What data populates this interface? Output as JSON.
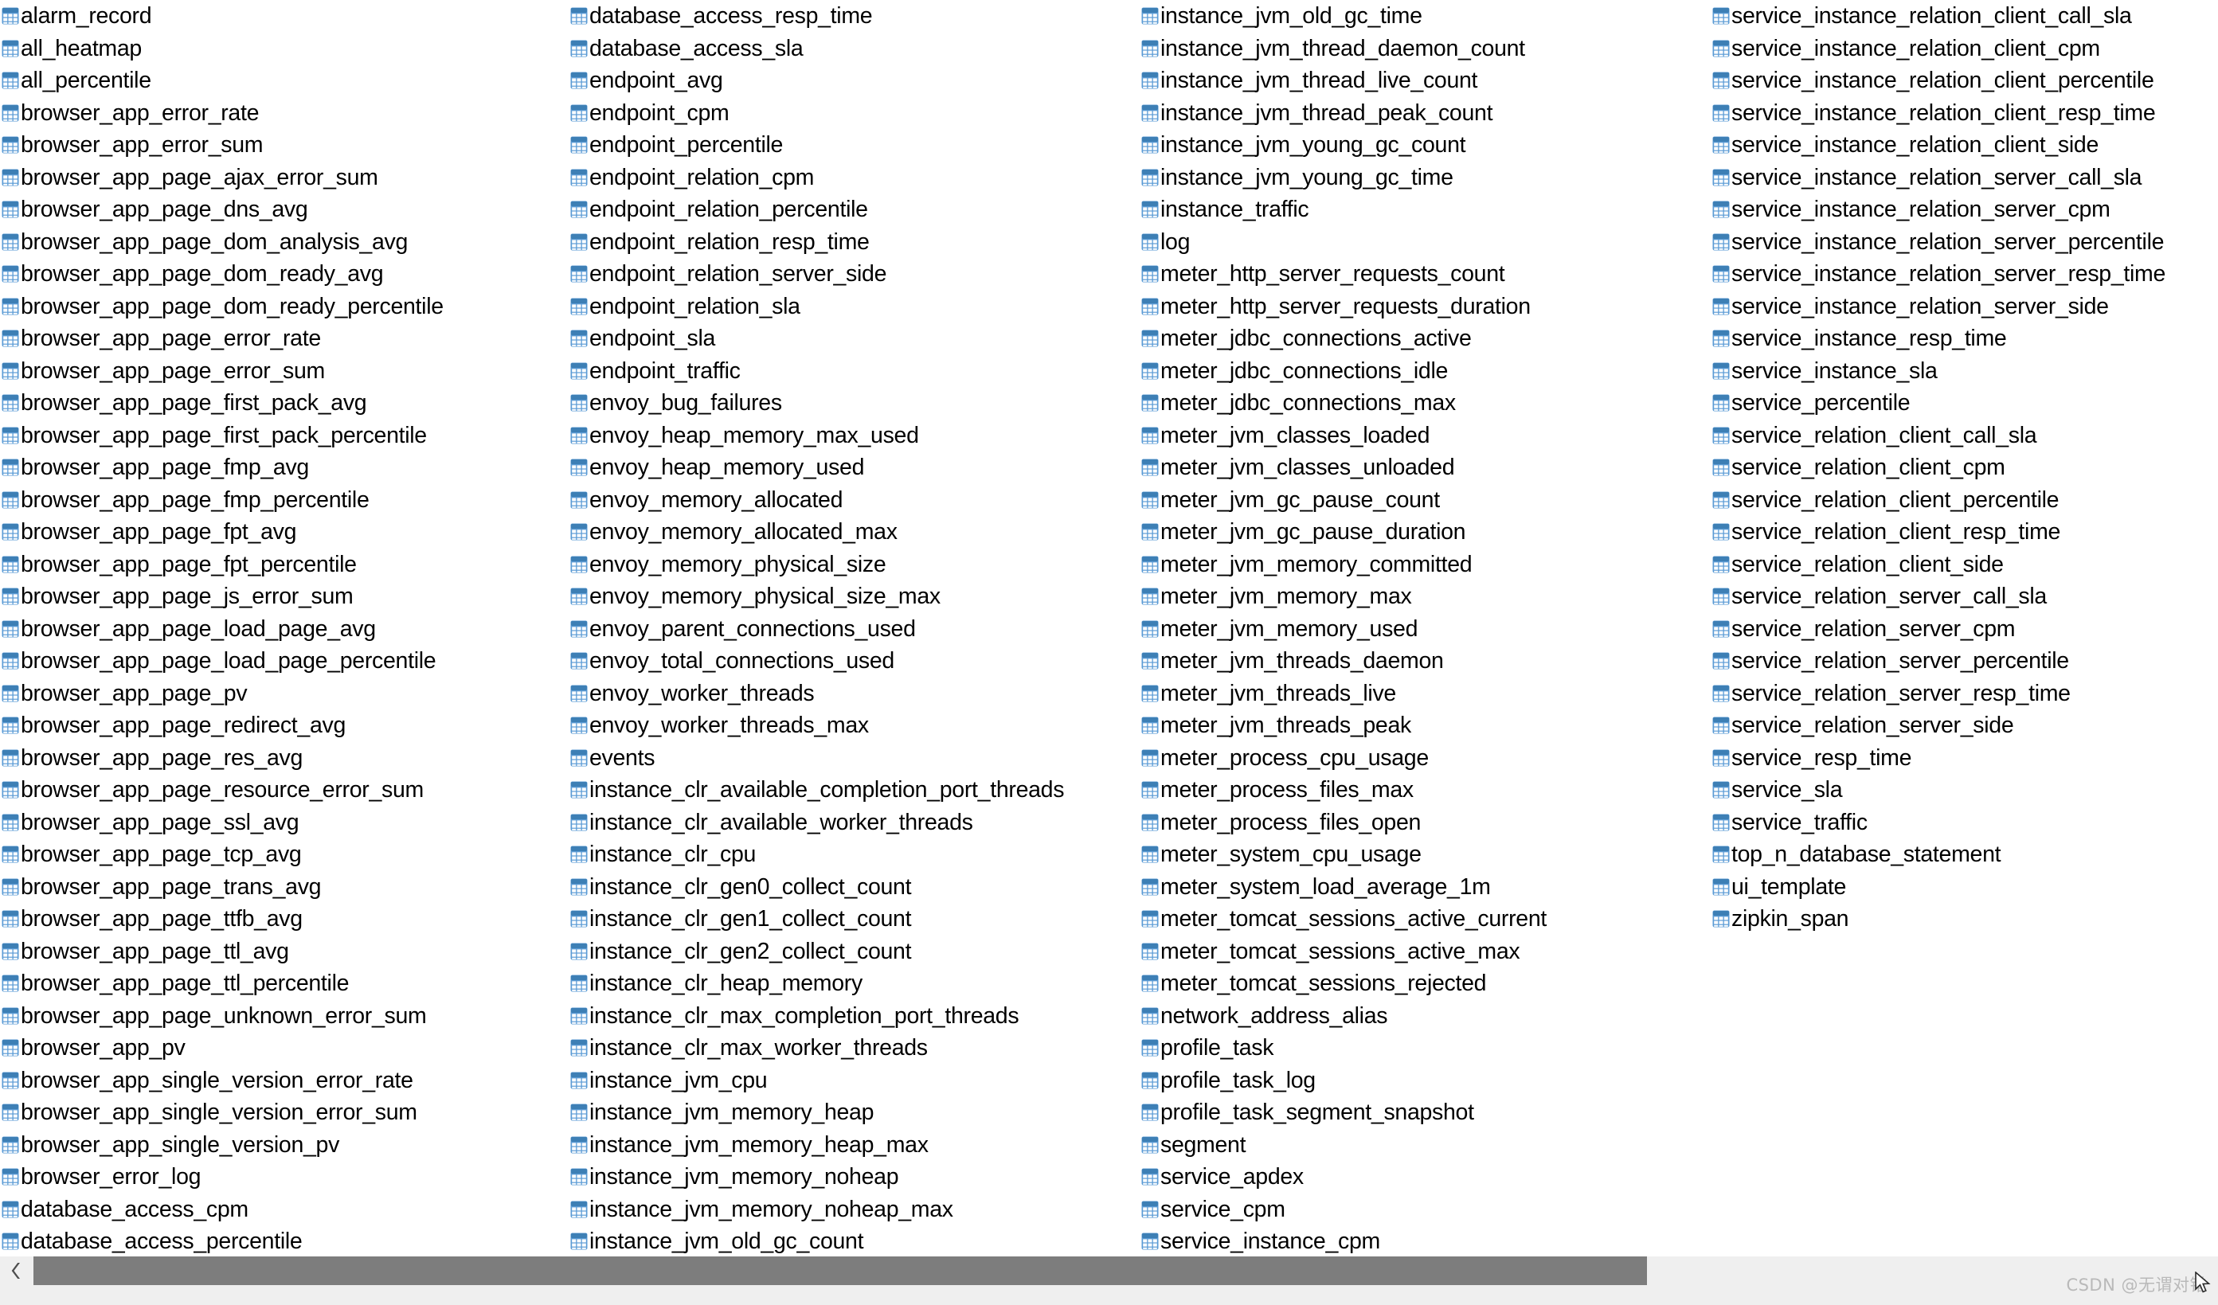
{
  "view": {
    "kind": "database-table-list",
    "icon_name": "table-icon",
    "icon_colors": {
      "header": "#3d7fb5",
      "grid": "#5b9bd5",
      "cell": "#ffffff"
    },
    "background": "#ffffff",
    "text_color": "#000000"
  },
  "columns": [
    {
      "name": "column-1",
      "items": [
        "alarm_record",
        "all_heatmap",
        "all_percentile",
        "browser_app_error_rate",
        "browser_app_error_sum",
        "browser_app_page_ajax_error_sum",
        "browser_app_page_dns_avg",
        "browser_app_page_dom_analysis_avg",
        "browser_app_page_dom_ready_avg",
        "browser_app_page_dom_ready_percentile",
        "browser_app_page_error_rate",
        "browser_app_page_error_sum",
        "browser_app_page_first_pack_avg",
        "browser_app_page_first_pack_percentile",
        "browser_app_page_fmp_avg",
        "browser_app_page_fmp_percentile",
        "browser_app_page_fpt_avg",
        "browser_app_page_fpt_percentile",
        "browser_app_page_js_error_sum",
        "browser_app_page_load_page_avg",
        "browser_app_page_load_page_percentile",
        "browser_app_page_pv",
        "browser_app_page_redirect_avg",
        "browser_app_page_res_avg",
        "browser_app_page_resource_error_sum",
        "browser_app_page_ssl_avg",
        "browser_app_page_tcp_avg",
        "browser_app_page_trans_avg",
        "browser_app_page_ttfb_avg",
        "browser_app_page_ttl_avg",
        "browser_app_page_ttl_percentile",
        "browser_app_page_unknown_error_sum",
        "browser_app_pv",
        "browser_app_single_version_error_rate",
        "browser_app_single_version_error_sum",
        "browser_app_single_version_pv",
        "browser_error_log",
        "database_access_cpm",
        "database_access_percentile"
      ]
    },
    {
      "name": "column-2",
      "items": [
        "database_access_resp_time",
        "database_access_sla",
        "endpoint_avg",
        "endpoint_cpm",
        "endpoint_percentile",
        "endpoint_relation_cpm",
        "endpoint_relation_percentile",
        "endpoint_relation_resp_time",
        "endpoint_relation_server_side",
        "endpoint_relation_sla",
        "endpoint_sla",
        "endpoint_traffic",
        "envoy_bug_failures",
        "envoy_heap_memory_max_used",
        "envoy_heap_memory_used",
        "envoy_memory_allocated",
        "envoy_memory_allocated_max",
        "envoy_memory_physical_size",
        "envoy_memory_physical_size_max",
        "envoy_parent_connections_used",
        "envoy_total_connections_used",
        "envoy_worker_threads",
        "envoy_worker_threads_max",
        "events",
        "instance_clr_available_completion_port_threads",
        "instance_clr_available_worker_threads",
        "instance_clr_cpu",
        "instance_clr_gen0_collect_count",
        "instance_clr_gen1_collect_count",
        "instance_clr_gen2_collect_count",
        "instance_clr_heap_memory",
        "instance_clr_max_completion_port_threads",
        "instance_clr_max_worker_threads",
        "instance_jvm_cpu",
        "instance_jvm_memory_heap",
        "instance_jvm_memory_heap_max",
        "instance_jvm_memory_noheap",
        "instance_jvm_memory_noheap_max",
        "instance_jvm_old_gc_count"
      ]
    },
    {
      "name": "column-3",
      "items": [
        "instance_jvm_old_gc_time",
        "instance_jvm_thread_daemon_count",
        "instance_jvm_thread_live_count",
        "instance_jvm_thread_peak_count",
        "instance_jvm_young_gc_count",
        "instance_jvm_young_gc_time",
        "instance_traffic",
        "log",
        "meter_http_server_requests_count",
        "meter_http_server_requests_duration",
        "meter_jdbc_connections_active",
        "meter_jdbc_connections_idle",
        "meter_jdbc_connections_max",
        "meter_jvm_classes_loaded",
        "meter_jvm_classes_unloaded",
        "meter_jvm_gc_pause_count",
        "meter_jvm_gc_pause_duration",
        "meter_jvm_memory_committed",
        "meter_jvm_memory_max",
        "meter_jvm_memory_used",
        "meter_jvm_threads_daemon",
        "meter_jvm_threads_live",
        "meter_jvm_threads_peak",
        "meter_process_cpu_usage",
        "meter_process_files_max",
        "meter_process_files_open",
        "meter_system_cpu_usage",
        "meter_system_load_average_1m",
        "meter_tomcat_sessions_active_current",
        "meter_tomcat_sessions_active_max",
        "meter_tomcat_sessions_rejected",
        "network_address_alias",
        "profile_task",
        "profile_task_log",
        "profile_task_segment_snapshot",
        "segment",
        "service_apdex",
        "service_cpm",
        "service_instance_cpm"
      ]
    },
    {
      "name": "column-4",
      "items": [
        "service_instance_relation_client_call_sla",
        "service_instance_relation_client_cpm",
        "service_instance_relation_client_percentile",
        "service_instance_relation_client_resp_time",
        "service_instance_relation_client_side",
        "service_instance_relation_server_call_sla",
        "service_instance_relation_server_cpm",
        "service_instance_relation_server_percentile",
        "service_instance_relation_server_resp_time",
        "service_instance_relation_server_side",
        "service_instance_resp_time",
        "service_instance_sla",
        "service_percentile",
        "service_relation_client_call_sla",
        "service_relation_client_cpm",
        "service_relation_client_percentile",
        "service_relation_client_resp_time",
        "service_relation_client_side",
        "service_relation_server_call_sla",
        "service_relation_server_cpm",
        "service_relation_server_percentile",
        "service_relation_server_resp_time",
        "service_relation_server_side",
        "service_resp_time",
        "service_sla",
        "service_traffic",
        "top_n_database_statement",
        "ui_template",
        "zipkin_span"
      ]
    }
  ],
  "scrollbar": {
    "orientation": "horizontal",
    "left_button_icon": "chevron-left-icon",
    "track_color": "#efefef",
    "thumb_color": "#7d7d7d"
  },
  "watermark": {
    "text": "CSDN @无谓对错"
  }
}
